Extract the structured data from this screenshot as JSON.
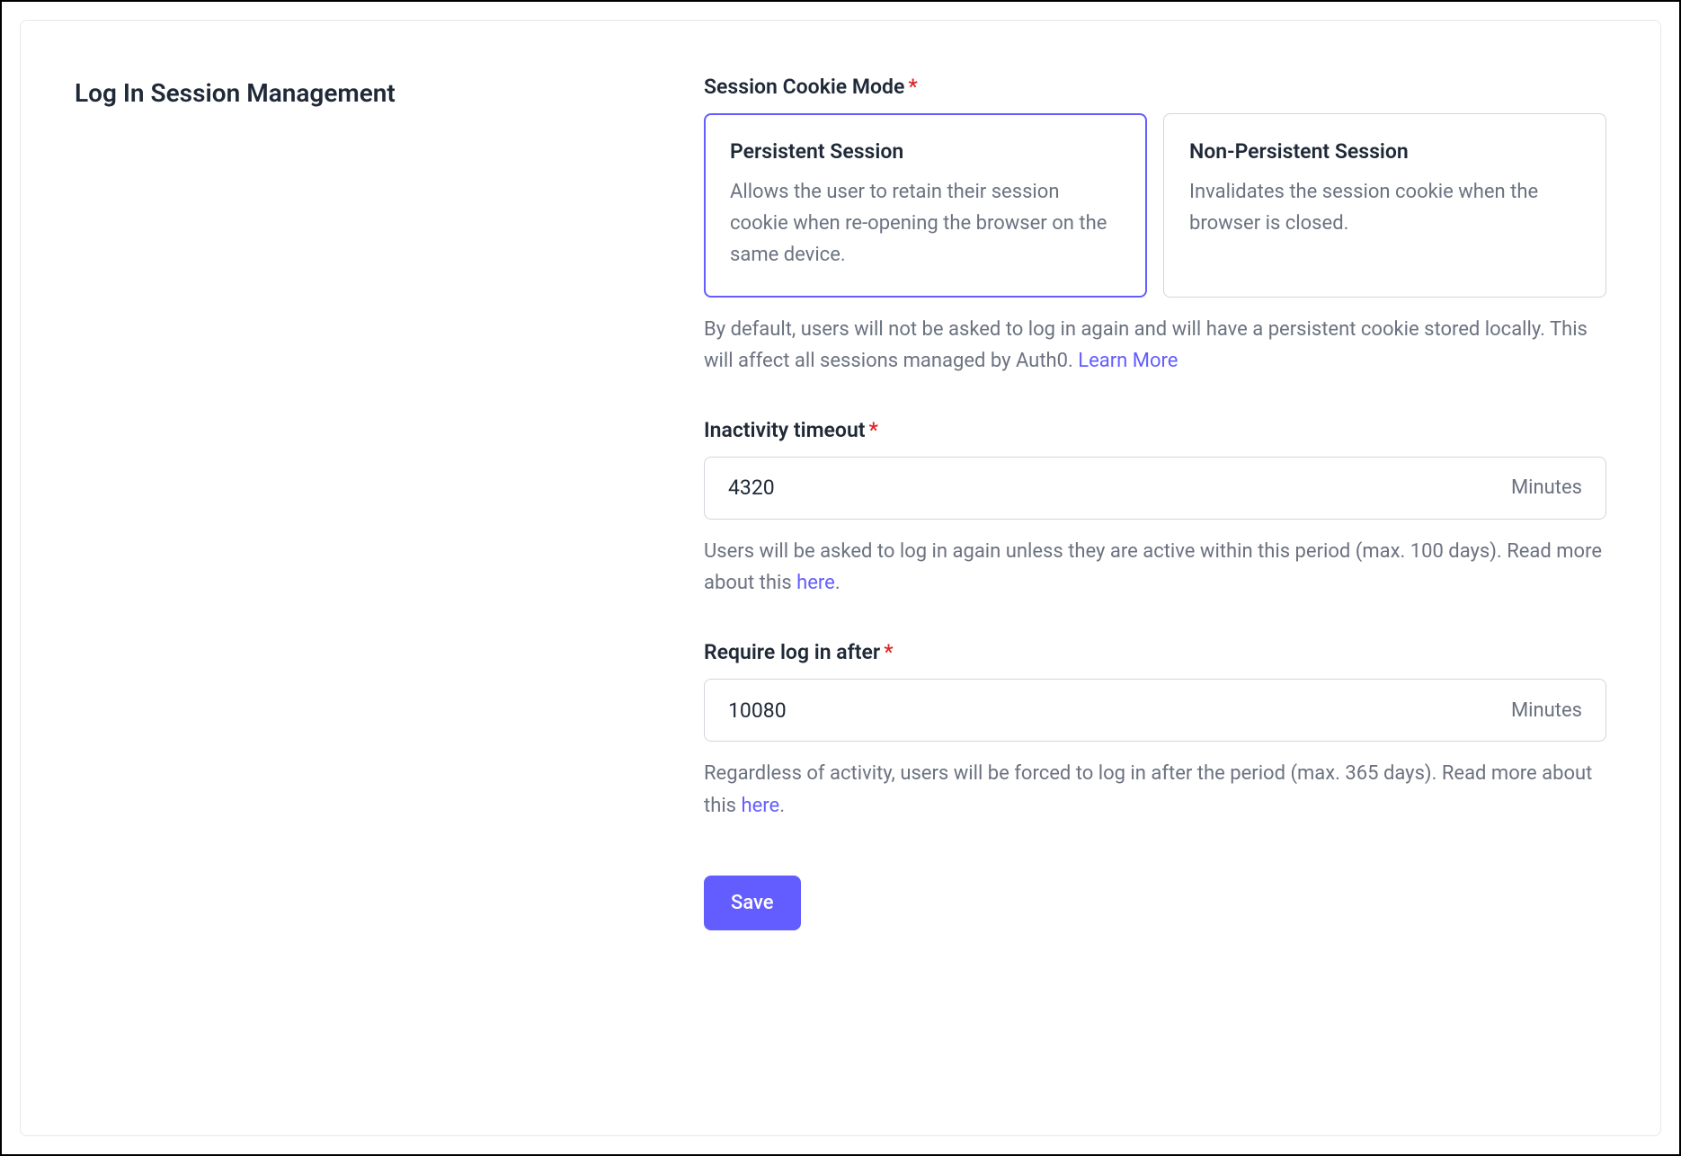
{
  "section": {
    "heading": "Log In Session Management"
  },
  "session_cookie_mode": {
    "label": "Session Cookie Mode",
    "options": [
      {
        "title": "Persistent Session",
        "description": "Allows the user to retain their session cookie when re-opening the browser on the same device.",
        "selected": true
      },
      {
        "title": "Non-Persistent Session",
        "description": "Invalidates the session cookie when the browser is closed.",
        "selected": false
      }
    ],
    "helper_prefix": "By default, users will not be asked to log in again and will have a persistent cookie stored locally. This will affect all sessions managed by Auth0. ",
    "helper_link": "Learn More"
  },
  "inactivity_timeout": {
    "label": "Inactivity timeout",
    "value": "4320",
    "suffix": "Minutes",
    "helper_prefix": "Users will be asked to log in again unless they are active within this period (max. 100 days). Read more about this ",
    "helper_link": "here",
    "helper_suffix": "."
  },
  "require_login_after": {
    "label": "Require log in after",
    "value": "10080",
    "suffix": "Minutes",
    "helper_prefix": "Regardless of activity, users will be forced to log in after the period (max. 365 days). Read more about this ",
    "helper_link": "here",
    "helper_suffix": "."
  },
  "actions": {
    "save": "Save"
  }
}
